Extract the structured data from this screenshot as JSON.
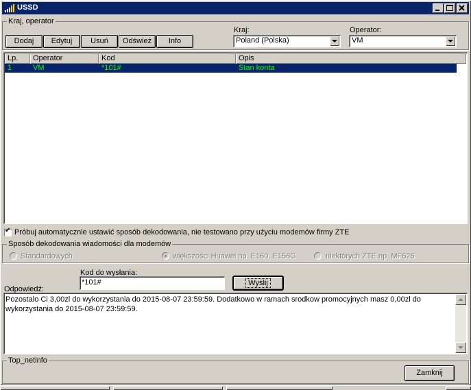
{
  "window": {
    "title": "USSD"
  },
  "country_group": {
    "legend": "Kraj, operator",
    "buttons": {
      "add": "Dodaj",
      "edit": "Edytuj",
      "delete": "Usuń",
      "refresh": "Odśwież",
      "info": "Info"
    },
    "country_label": "Kraj:",
    "country_value": "Poland (Polska)",
    "operator_label": "Operator:",
    "operator_value": "VM"
  },
  "table": {
    "columns": [
      "Lp.",
      "Operator",
      "Kod",
      "Opis"
    ],
    "rows": [
      {
        "lp": "1",
        "operator": "VM",
        "kod": "*101#",
        "opis": "Stan konta"
      }
    ]
  },
  "auto_decode": {
    "checked": true,
    "label": "Próbuj automatycznie ustawić sposób dekodowania, nie testowano przy użyciu modemów firmy ZTE"
  },
  "decode_group": {
    "legend": "Sposób dekodowania wiadomości dla modemów",
    "options": [
      "Standardowych",
      "większości Huawei  np. E160, E156G",
      "niektórych ZTE np. MF626"
    ],
    "selected_index": 1
  },
  "send": {
    "code_label": "Kod do wysłania:",
    "code_value": "*101#",
    "send_button": "Wyślij"
  },
  "response": {
    "label": "Odpowiedź:",
    "text": "Pozostalo Ci 3,00zl do wykorzystania do 2015-08-07 23:59:59. Dodatkowo w ramach srodkow promocyjnych masz 0,00zl do wykorzystania do 2015-08-07 23:59:59."
  },
  "netinfo": {
    "legend": "Top_netinfo"
  },
  "close_button": "Zamknij",
  "colors": {
    "selection_bg": "#0a246a",
    "selection_fg": "#00ff00",
    "face": "#d4d0c8"
  }
}
